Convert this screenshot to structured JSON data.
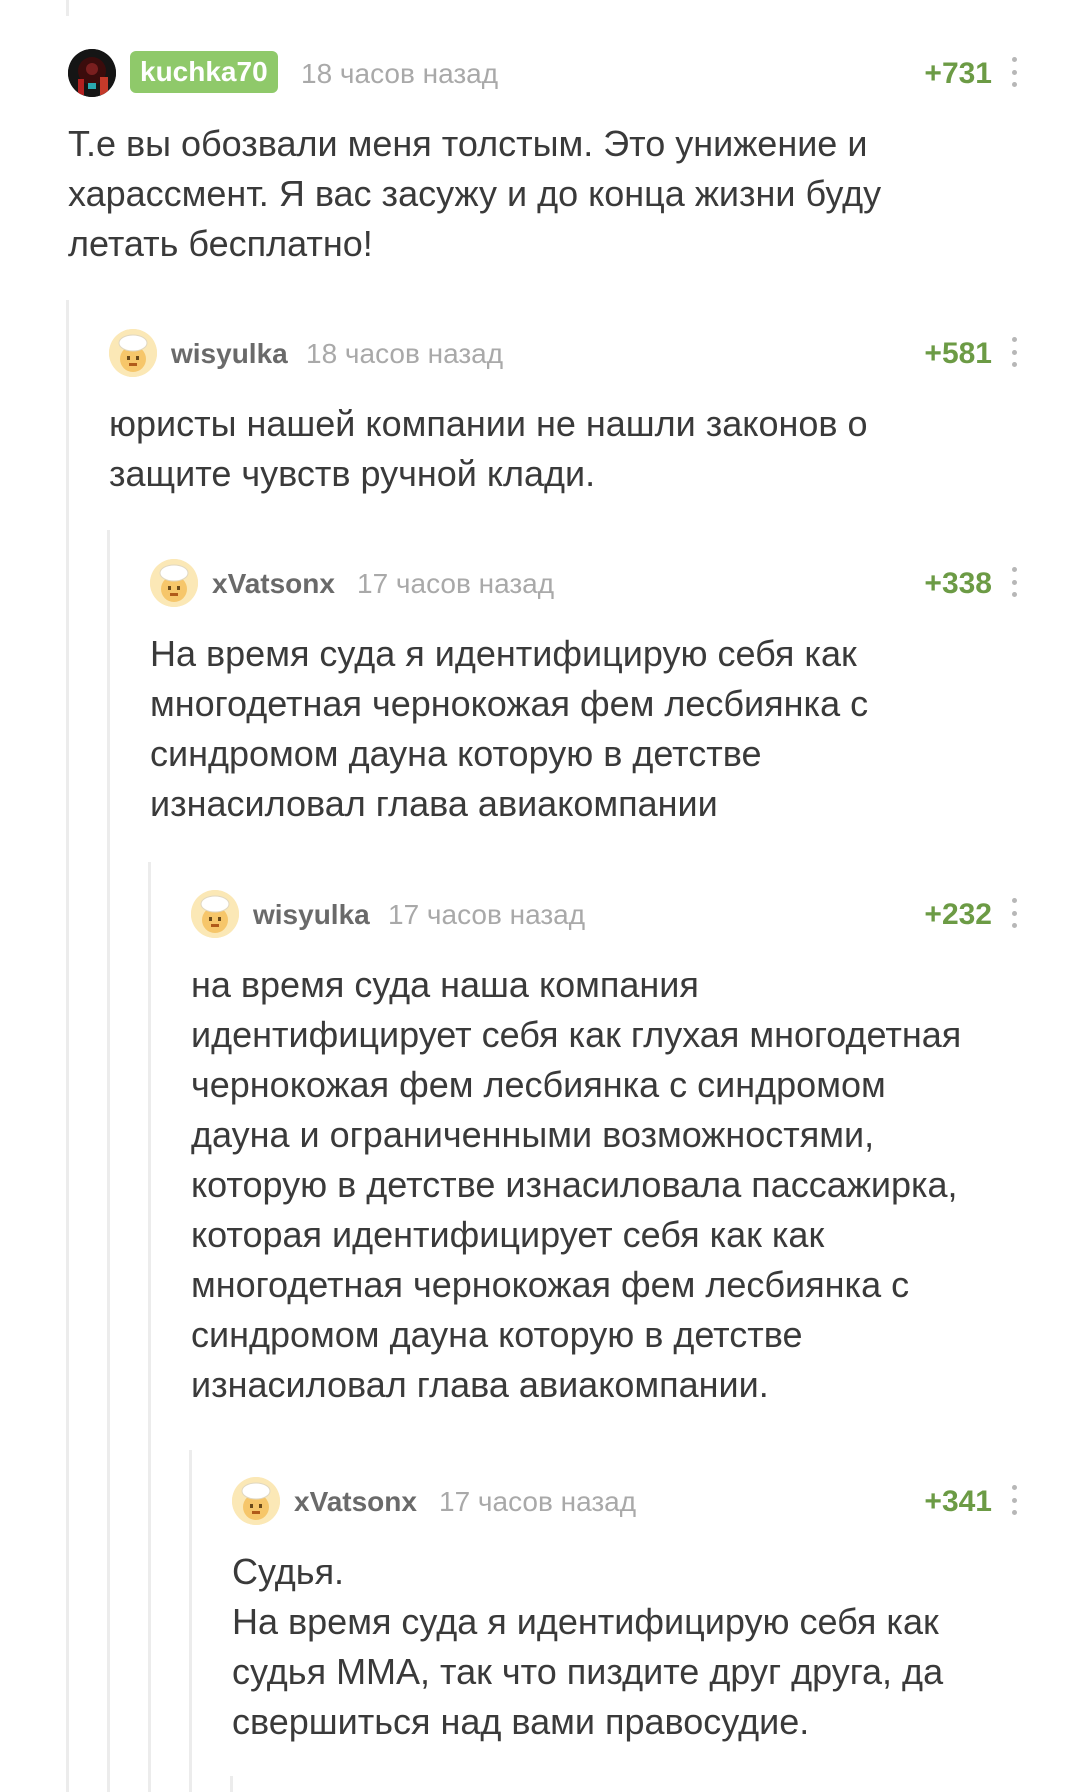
{
  "comments": [
    {
      "author": "kuchka70",
      "time": "18 часов назад",
      "rating": "+731",
      "text": "Т.е вы обозвали меня толстым. Это унижение и\nхарассмент. Я вас засужу и до конца жизни буду\nлетать бесплатно!"
    },
    {
      "author": "wisyulka",
      "time": "18 часов назад",
      "rating": "+581",
      "text": "юристы нашей компании не нашли законов о\nзащите чувств ручной клади."
    },
    {
      "author": "xVatsonx",
      "time": "17 часов назад",
      "rating": "+338",
      "text": "На время суда я идентифицирую себя как\nмногодетная чернокожая фем лесбиянка с\nсиндромом дауна которую в детстве\nизнасиловал глава авиакомпании"
    },
    {
      "author": "wisyulka",
      "time": "17 часов назад",
      "rating": "+232",
      "text": "на время суда наша компания\nидентифицирует себя как глухая многодетная\nчернокожая фем лесбиянка с синдромом\nдауна и ограниченными возможностями,\nкоторую в детстве изнасиловала пассажирка,\nкоторая идентифицирует себя как как\nмногодетная чернокожая фем лесбиянка с\nсиндромом дауна которую в детстве\nизнасиловал глава авиакомпании."
    },
    {
      "author": "xVatsonx",
      "time": "17 часов назад",
      "rating": "+341",
      "text": "Судья.\nНа время суда я идентифицирую себя как\nсудья ММА, так что пиздите друг друга, да\nсвершиться над вами правосудие."
    }
  ],
  "colors": {
    "rating": "#6c9b45",
    "badge": "#8fc96a",
    "time": "#a9a9a9",
    "thread_line": "#ececec"
  },
  "icons": [
    "more-vertical-icon",
    "avatar-image",
    "chef-avatar-icon"
  ]
}
